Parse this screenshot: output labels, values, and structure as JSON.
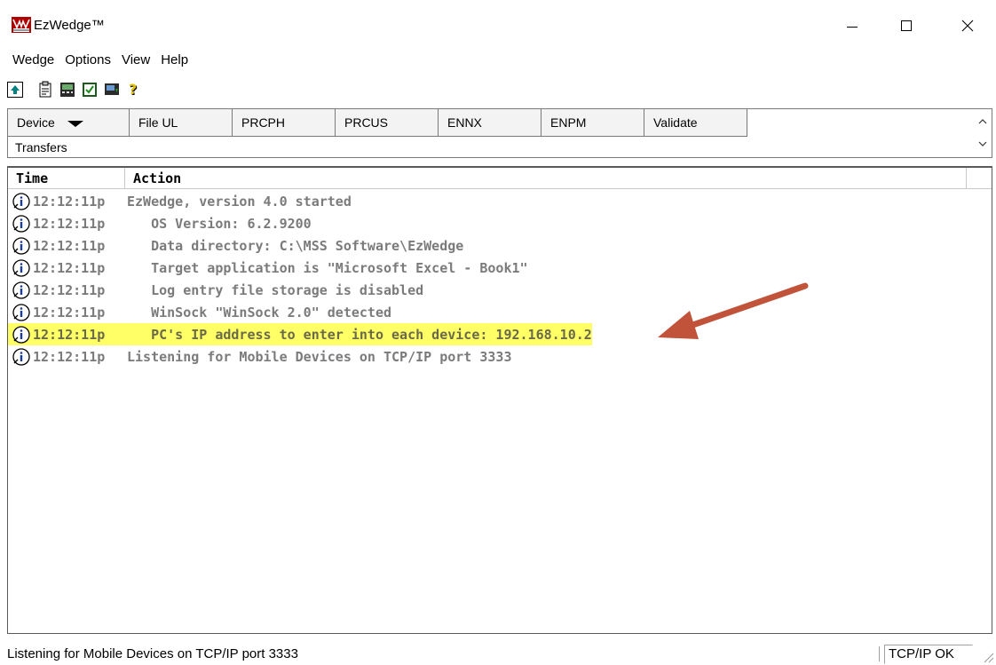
{
  "window": {
    "title": "EzWedge™"
  },
  "menu": [
    "Wedge",
    "Options",
    "View",
    "Help"
  ],
  "tabs": {
    "device_label": "Device",
    "items": [
      "File UL",
      "PRCPH",
      "PRCUS",
      "ENNX",
      "ENPM",
      "Validate"
    ],
    "second_row": "Transfers"
  },
  "log": {
    "columns": {
      "time": "Time",
      "action": "Action"
    },
    "rows": [
      {
        "time": "12:12:11p",
        "action": "EzWedge, version 4.0 started"
      },
      {
        "time": "12:12:11p",
        "action": "   OS Version: 6.2.9200"
      },
      {
        "time": "12:12:11p",
        "action": "   Data directory: C:\\MSS Software\\EzWedge"
      },
      {
        "time": "12:12:11p",
        "action": "   Target application is \"Microsoft Excel - Book1\""
      },
      {
        "time": "12:12:11p",
        "action": "   Log entry file storage is disabled"
      },
      {
        "time": "12:12:11p",
        "action": "   WinSock \"WinSock 2.0\" detected"
      },
      {
        "time": "12:12:11p",
        "action": "   PC's IP address to enter into each device: 192.168.10.2",
        "highlighted": true
      },
      {
        "time": "12:12:11p",
        "action": "Listening for Mobile Devices on TCP/IP port 3333"
      }
    ],
    "row_icon": "info-icon",
    "highlight_color": "#ffff66"
  },
  "annotation": {
    "arrow_color": "#c0533a"
  },
  "status": {
    "text": "Listening for Mobile Devices on TCP/IP port 3333",
    "badge": "TCP/IP OK"
  }
}
